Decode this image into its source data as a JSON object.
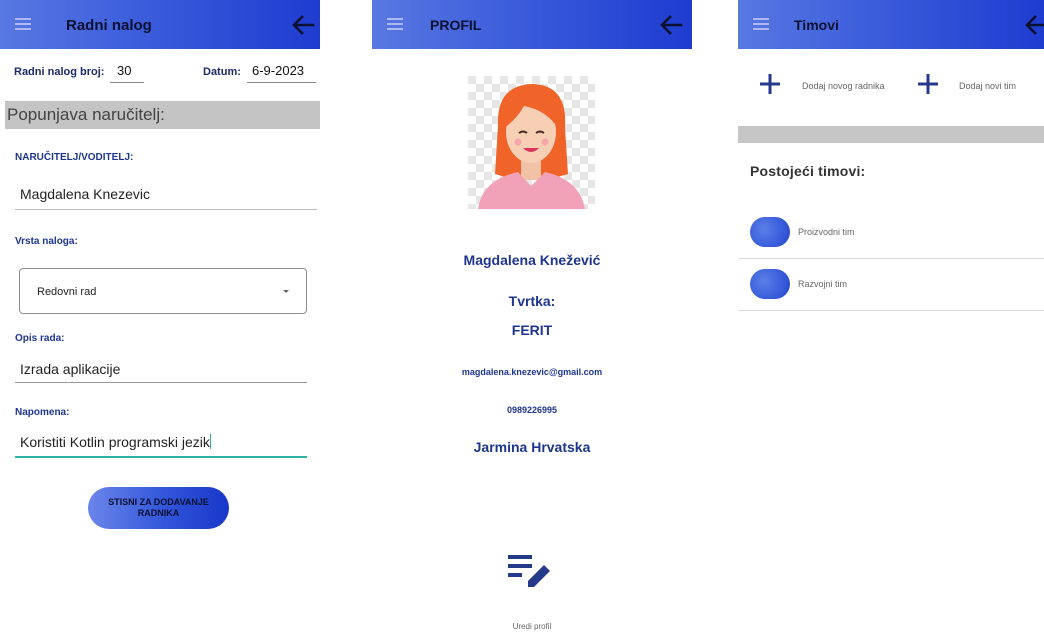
{
  "screens": {
    "work_order": {
      "title": "Radni nalog",
      "order_number_label": "Radni nalog broj:",
      "order_number_value": "30",
      "date_label": "Datum:",
      "date_value": "6-9-2023",
      "section_header": "Popunjava naručitelj:",
      "client_label": "NARUČITELJ/VODITELJ:",
      "client_value": "Magdalena Knezevic",
      "order_type_label": "Vrsta naloga:",
      "order_type_value": "Redovni rad",
      "work_desc_label": "Opis rada:",
      "work_desc_value": "Izrada aplikacije",
      "note_label": "Napomena:",
      "note_value": "Koristiti Kotlin programski jezik",
      "add_workers_button": "STISNI ZA DODAVANJE RADNIKA"
    },
    "profile": {
      "title": "PROFIL",
      "name": "Magdalena Knežević",
      "company_label": "Tvrtka:",
      "company_value": "FERIT",
      "email": "magdalena.knezevic@gmail.com",
      "phone": "0989226995",
      "location": "Jarmina Hrvatska",
      "edit_label": "Uredi profil"
    },
    "teams": {
      "title": "Timovi",
      "add_worker_label": "Dodaj novog radnika",
      "add_team_label": "Dodaj novi tim",
      "existing_teams_title": "Postojeći timovi:",
      "teams": [
        {
          "name": "Proizvodni tim"
        },
        {
          "name": "Razvojni tim"
        }
      ]
    }
  },
  "icons": {
    "menu": "hamburger-icon",
    "back": "arrow-left-icon",
    "add": "plus-icon",
    "edit": "edit-list-icon"
  },
  "colors": {
    "appbar_start": "#5878e2",
    "appbar_end": "#1e3cd0",
    "label_blue": "#1d3590",
    "accent_teal": "#2bb4a4",
    "section_grey": "#c4c4c4"
  }
}
